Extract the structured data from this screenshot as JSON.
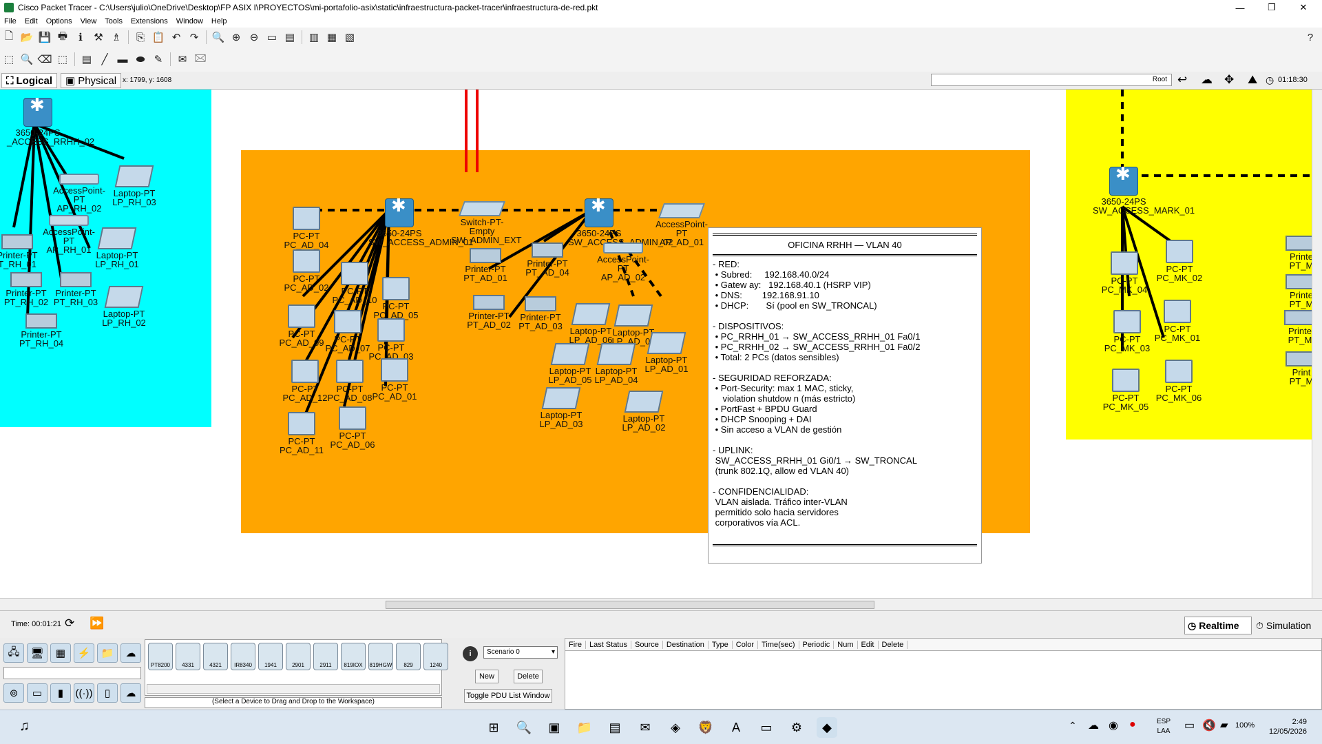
{
  "titlebar": {
    "title": "Cisco Packet Tracer - C:\\Users\\julio\\OneDrive\\Desktop\\FP ASIX I\\PROYECTOS\\mi-portafolio-asix\\static\\infraestructura-packet-tracer\\infraestructura-de-red.pkt",
    "min": "—",
    "max": "❐",
    "close": "✕"
  },
  "menu": [
    "File",
    "Edit",
    "Options",
    "View",
    "Tools",
    "Extensions",
    "Window",
    "Help"
  ],
  "modebar": {
    "logical": "Logical",
    "physical": "Physical",
    "coords": "x: 1799, y: 1608",
    "root": "Root",
    "clock": "01:18:30"
  },
  "zones": {
    "left_color": "#00ffff",
    "center_color": "#ffa500",
    "right_color": "#ffff00"
  },
  "devices": {
    "rrhh": [
      {
        "l1": "3650-24PS",
        "l2": "_ACCESS_RRHH_02"
      },
      {
        "l1": "AccessPoint-PT",
        "l2": "AP_RH_02"
      },
      {
        "l1": "Laptop-PT",
        "l2": "LP_RH_03"
      },
      {
        "l1": "AccessPoint-PT",
        "l2": "AP_RH_01"
      },
      {
        "l1": "Printer-PT",
        "l2": "T_RH_01"
      },
      {
        "l1": "Laptop-PT",
        "l2": "LP_RH_01"
      },
      {
        "l1": "Printer-PT",
        "l2": "PT_RH_02"
      },
      {
        "l1": "Printer-PT",
        "l2": "PT_RH_03"
      },
      {
        "l1": "Laptop-PT",
        "l2": "LP_RH_02"
      },
      {
        "l1": "Printer-PT",
        "l2": "PT_RH_04"
      }
    ],
    "admin": [
      {
        "l1": "PC-PT",
        "l2": "PC_AD_04"
      },
      {
        "l1": "3650-24PS",
        "l2": "SW_ACCESS_ADMIN_01"
      },
      {
        "l1": "Switch-PT-Empty",
        "l2": "SW_ADMIN_EXT"
      },
      {
        "l1": "3650-24PS",
        "l2": "SW_ACCESS_ADMIN_02"
      },
      {
        "l1": "AccessPoint-PT",
        "l2": "AP_AD_01"
      },
      {
        "l1": "PC-PT",
        "l2": "PC_AD_02"
      },
      {
        "l1": "PC-PT",
        "l2": "PC_AD_10"
      },
      {
        "l1": "PC-PT",
        "l2": "PC_AD_05"
      },
      {
        "l1": "Printer-PT",
        "l2": "PT_AD_01"
      },
      {
        "l1": "Printer-PT",
        "l2": "PT_AD_04"
      },
      {
        "l1": "AccessPoint-PT",
        "l2": "AP_AD_02"
      },
      {
        "l1": "PC-PT",
        "l2": "PC_AD_09"
      },
      {
        "l1": "PC-PT",
        "l2": "PC_AD_07"
      },
      {
        "l1": "PC-PT",
        "l2": "PC_AD_03"
      },
      {
        "l1": "Printer-PT",
        "l2": "PT_AD_02"
      },
      {
        "l1": "Printer-PT",
        "l2": "PT_AD_03"
      },
      {
        "l1": "Laptop-PT",
        "l2": "LP_AD_06"
      },
      {
        "l1": "Laptop-PT",
        "l2": "LP_AD_07"
      },
      {
        "l1": "PC-PT",
        "l2": "PC_AD_12"
      },
      {
        "l1": "PC-PT",
        "l2": "PC_AD_08"
      },
      {
        "l1": "PC-PT",
        "l2": "PC_AD_01"
      },
      {
        "l1": "Laptop-PT",
        "l2": "LP_AD_05"
      },
      {
        "l1": "Laptop-PT",
        "l2": "LP_AD_04"
      },
      {
        "l1": "Laptop-PT",
        "l2": "LP_AD_01"
      },
      {
        "l1": "PC-PT",
        "l2": "PC_AD_11"
      },
      {
        "l1": "PC-PT",
        "l2": "PC_AD_06"
      },
      {
        "l1": "Laptop-PT",
        "l2": "LP_AD_03"
      },
      {
        "l1": "Laptop-PT",
        "l2": "LP_AD_02"
      }
    ],
    "mark": [
      {
        "l1": "3650-24PS",
        "l2": "SW_ACCESS_MARK_01"
      },
      {
        "l1": "PC-PT",
        "l2": "PC_MK_04"
      },
      {
        "l1": "PC-PT",
        "l2": "PC_MK_02"
      },
      {
        "l1": "PC-PT",
        "l2": "PC_MK_03"
      },
      {
        "l1": "PC-PT",
        "l2": "PC_MK_01"
      },
      {
        "l1": "PC-PT",
        "l2": "PC_MK_05"
      },
      {
        "l1": "PC-PT",
        "l2": "PC_MK_06"
      },
      {
        "l1": "Printe",
        "l2": "PT_M"
      },
      {
        "l1": "Printe",
        "l2": "PT_M"
      },
      {
        "l1": "Printe",
        "l2": "PT_M"
      },
      {
        "l1": "Print",
        "l2": "PT_M"
      }
    ]
  },
  "note": {
    "title": "OFICINA RRHH — VLAN 40",
    "body": "- RED:\n • Subred:     192.168.40.0/24\n • Gatew ay:   192.168.40.1 (HSRP VIP)\n • DNS:        192.168.91.10\n • DHCP:       Sí (pool en SW_TRONCAL)\n\n- DISPOSITIVOS:\n • PC_RRHH_01 → SW_ACCESS_RRHH_01 Fa0/1\n • PC_RRHH_02 → SW_ACCESS_RRHH_01 Fa0/2\n • Total: 2 PCs (datos sensibles)\n\n- SEGURIDAD REFORZADA:\n • Port-Security: max 1 MAC, sticky,\n    violation shutdow n (más estricto)\n • PortFast + BPDU Guard\n • DHCP Snooping + DAI\n • Sin acceso a VLAN de gestión\n\n- UPLINK:\n SW_ACCESS_RRHH_01 Gi0/1 → SW_TRONCAL\n (trunk 802.1Q, allow ed VLAN 40)\n\n- CONFIDENCIALIDAD:\n VLAN aislada. Tráfico inter-VLAN\n permitido solo hacia servidores\n corporativos vía ACL."
  },
  "time": {
    "label": "Time: 00:01:21",
    "realtime": "Realtime",
    "simulation": "Simulation"
  },
  "device_models": [
    "PT8200",
    "4331",
    "4321",
    "IR8340",
    "1941",
    "2901",
    "2911",
    "819IOX",
    "819HGW",
    "829",
    "1240"
  ],
  "device_hint": "(Select a Device to Drag and Drop to the Workspace)",
  "scenario": {
    "value": "Scenario 0",
    "new": "New",
    "delete": "Delete",
    "toggle": "Toggle PDU List Window"
  },
  "pdu_columns": [
    "Fire",
    "Last Status",
    "Source",
    "Destination",
    "Type",
    "Color",
    "Time(sec)",
    "Periodic",
    "Num",
    "Edit",
    "Delete"
  ],
  "taskbar": {
    "lang1": "ESP",
    "lang2": "LAA",
    "battery": "100%",
    "time": "2:49",
    "date": "12/05/2026"
  }
}
